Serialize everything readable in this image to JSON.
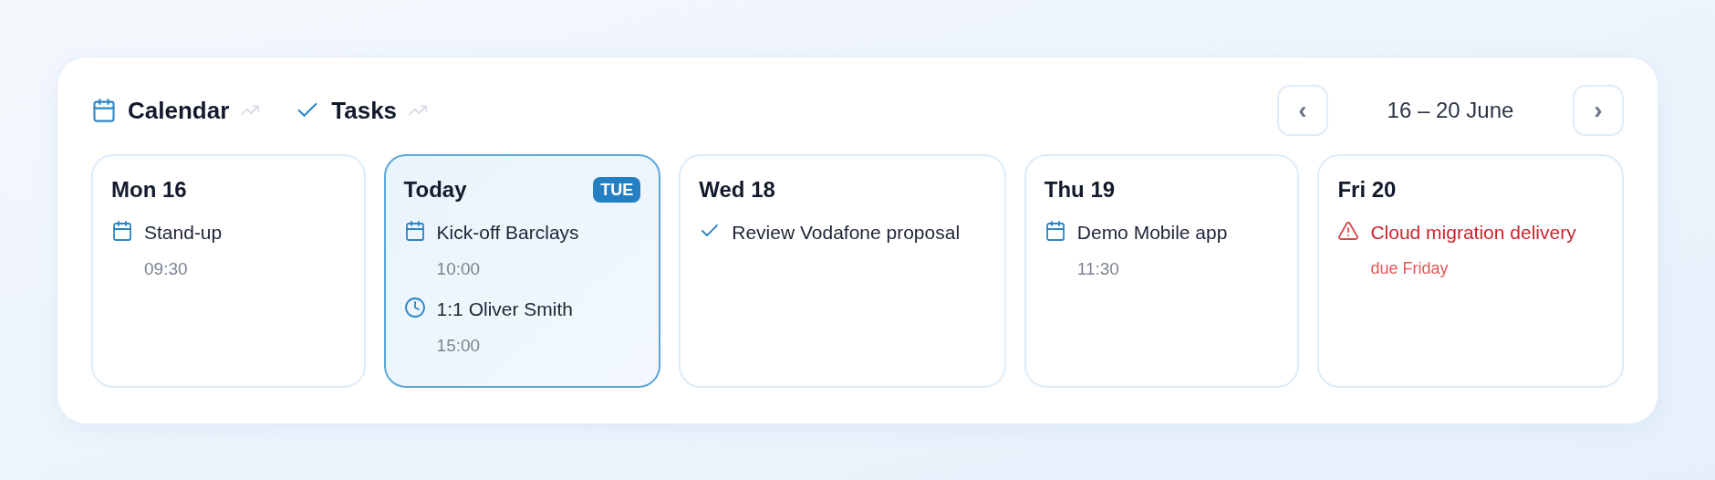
{
  "tabs": [
    {
      "label": "Calendar",
      "kind": "calendar"
    },
    {
      "label": "Tasks",
      "kind": "tasks"
    }
  ],
  "range": {
    "prev": "‹",
    "label": "16 – 20 June",
    "next": "›"
  },
  "days": [
    {
      "title": "Mon 16",
      "selected": false,
      "items": [
        {
          "kind": "event",
          "title": "Stand-up",
          "sub": "09:30"
        }
      ]
    },
    {
      "title": "Today",
      "badge": "TUE",
      "selected": true,
      "items": [
        {
          "kind": "event",
          "title": "Kick-off Barclays",
          "sub": "10:00"
        },
        {
          "kind": "meeting",
          "title": "1:1 Oliver Smith",
          "sub": "15:00"
        }
      ]
    },
    {
      "title": "Wed 18",
      "selected": false,
      "items": [
        {
          "kind": "task",
          "title": "Review Vodafone proposal"
        }
      ]
    },
    {
      "title": "Thu 19",
      "selected": false,
      "items": [
        {
          "kind": "event",
          "title": "Demo Mobile app",
          "sub": "11:30"
        }
      ]
    },
    {
      "title": "Fri 20",
      "selected": false,
      "items": [
        {
          "kind": "overdue",
          "title": "Cloud migration delivery",
          "sub": "due Friday"
        }
      ]
    }
  ]
}
